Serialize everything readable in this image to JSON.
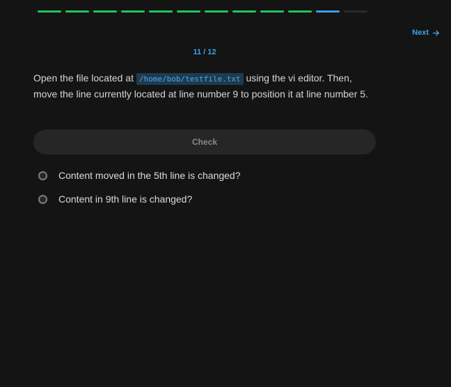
{
  "progress": {
    "segments": [
      "done",
      "done",
      "done",
      "done",
      "done",
      "done",
      "done",
      "done",
      "done",
      "done",
      "current",
      "todo"
    ],
    "colors": {
      "done": "#22c55e",
      "current": "#3b9ee8",
      "todo": "#2a2a2a"
    }
  },
  "nav": {
    "next_label": "Next",
    "next_icon": "arrow-right-icon"
  },
  "counter": "11 / 12",
  "question": {
    "text_before": "Open the file located at ",
    "code": "/home/bob/testfile.txt",
    "text_after": " using the vi editor. Then, move the line currently located at line number 9 to position it at line number 5."
  },
  "check_label": "Check",
  "options": [
    {
      "label": "Content moved in the 5th line is changed?"
    },
    {
      "label": "Content in 9th line is changed?"
    }
  ]
}
